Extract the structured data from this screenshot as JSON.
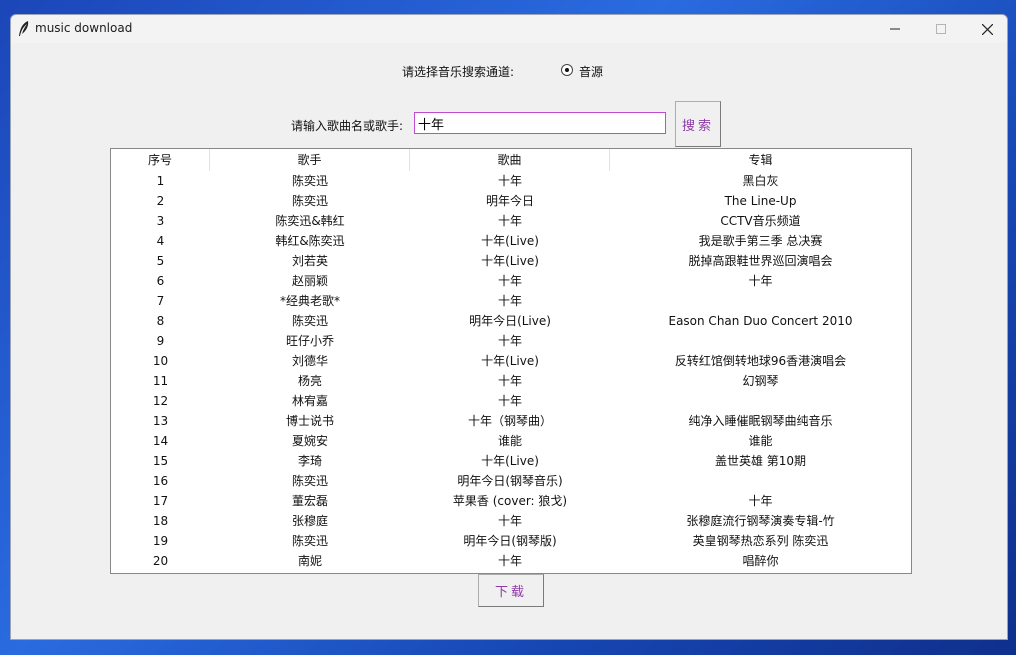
{
  "window": {
    "title": "music download"
  },
  "channel": {
    "label": "请选择音乐搜索通道:",
    "option_label": "音源",
    "selected": true
  },
  "search": {
    "label": "请输入歌曲名或歌手:",
    "value": "十年",
    "button_label": "搜索"
  },
  "table": {
    "columns": [
      "序号",
      "歌手",
      "歌曲",
      "专辑"
    ],
    "rows": [
      [
        "1",
        "陈奕迅",
        "十年",
        "黑白灰"
      ],
      [
        "2",
        "陈奕迅",
        "明年今日",
        "The Line-Up"
      ],
      [
        "3",
        "陈奕迅&韩红",
        "十年",
        "CCTV音乐频道"
      ],
      [
        "4",
        "韩红&陈奕迅",
        "十年(Live)",
        "我是歌手第三季 总决赛"
      ],
      [
        "5",
        "刘若英",
        "十年(Live)",
        "脱掉高跟鞋世界巡回演唱会"
      ],
      [
        "6",
        "赵丽颖",
        "十年",
        "十年"
      ],
      [
        "7",
        "*经典老歌*",
        "十年",
        ""
      ],
      [
        "8",
        "陈奕迅",
        "明年今日(Live)",
        "Eason Chan Duo Concert 2010"
      ],
      [
        "9",
        "旺仔小乔",
        "十年",
        ""
      ],
      [
        "10",
        "刘德华",
        "十年(Live)",
        "反转红馆倒转地球96香港演唱会"
      ],
      [
        "11",
        "杨亮",
        "十年",
        "幻钢琴"
      ],
      [
        "12",
        "林宥嘉",
        "十年",
        ""
      ],
      [
        "13",
        "博士说书",
        "十年（钢琴曲）",
        "纯净入睡催眠钢琴曲纯音乐"
      ],
      [
        "14",
        "夏婉安",
        "谁能",
        "谁能"
      ],
      [
        "15",
        "李琦",
        "十年(Live)",
        "盖世英雄 第10期"
      ],
      [
        "16",
        "陈奕迅",
        "明年今日(钢琴音乐)",
        ""
      ],
      [
        "17",
        "董宏磊",
        "苹果香 (cover: 狼戈)",
        "十年"
      ],
      [
        "18",
        "张穆庭",
        "十年",
        "张穆庭流行钢琴演奏专辑-竹"
      ],
      [
        "19",
        "陈奕迅",
        "明年今日(钢琴版)",
        "英皇钢琴热恋系列 陈奕迅"
      ],
      [
        "20",
        "南妮",
        "十年",
        "唱醉你"
      ]
    ]
  },
  "download": {
    "button_label": "下载"
  },
  "icons": {
    "app": "feather-icon",
    "minimize": "minimize-icon",
    "maximize": "maximize-icon",
    "close": "close-icon"
  },
  "colors": {
    "button_text": "#8e3aa8",
    "input_border": "#c24bd0",
    "window_bg": "#f0f0f0"
  }
}
